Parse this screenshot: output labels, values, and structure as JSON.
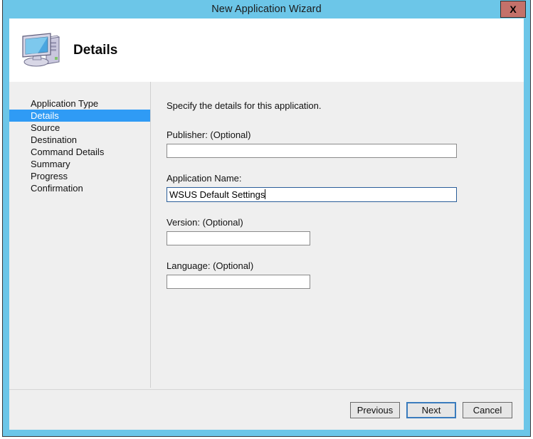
{
  "window": {
    "title": "New Application Wizard",
    "close_label": "X",
    "frame_color": "#6cc6e8",
    "close_color": "#c4716a"
  },
  "header": {
    "icon": "computer-icon",
    "title": "Details"
  },
  "sidebar": {
    "items": [
      {
        "label": "Application Type",
        "selected": false
      },
      {
        "label": "Details",
        "selected": true
      },
      {
        "label": "Source",
        "selected": false
      },
      {
        "label": "Destination",
        "selected": false
      },
      {
        "label": "Command Details",
        "selected": false
      },
      {
        "label": "Summary",
        "selected": false
      },
      {
        "label": "Progress",
        "selected": false
      },
      {
        "label": "Confirmation",
        "selected": false
      }
    ],
    "selected_color": "#2f9bf5"
  },
  "content": {
    "intro": "Specify the details for this application.",
    "fields": [
      {
        "label": "Publisher: (Optional)",
        "value": "",
        "placeholder": "",
        "width": "wide",
        "focused": false
      },
      {
        "label": "Application Name:",
        "value": "WSUS Default Settings",
        "placeholder": "",
        "width": "wide",
        "focused": true
      },
      {
        "label": "Version: (Optional)",
        "value": "",
        "placeholder": "",
        "width": "narrow",
        "focused": false
      },
      {
        "label": "Language: (Optional)",
        "value": "",
        "placeholder": "",
        "width": "narrow",
        "focused": false
      }
    ]
  },
  "footer": {
    "buttons": [
      {
        "label": "Previous",
        "default": false
      },
      {
        "label": "Next",
        "default": true
      },
      {
        "label": "Cancel",
        "default": false
      }
    ]
  }
}
